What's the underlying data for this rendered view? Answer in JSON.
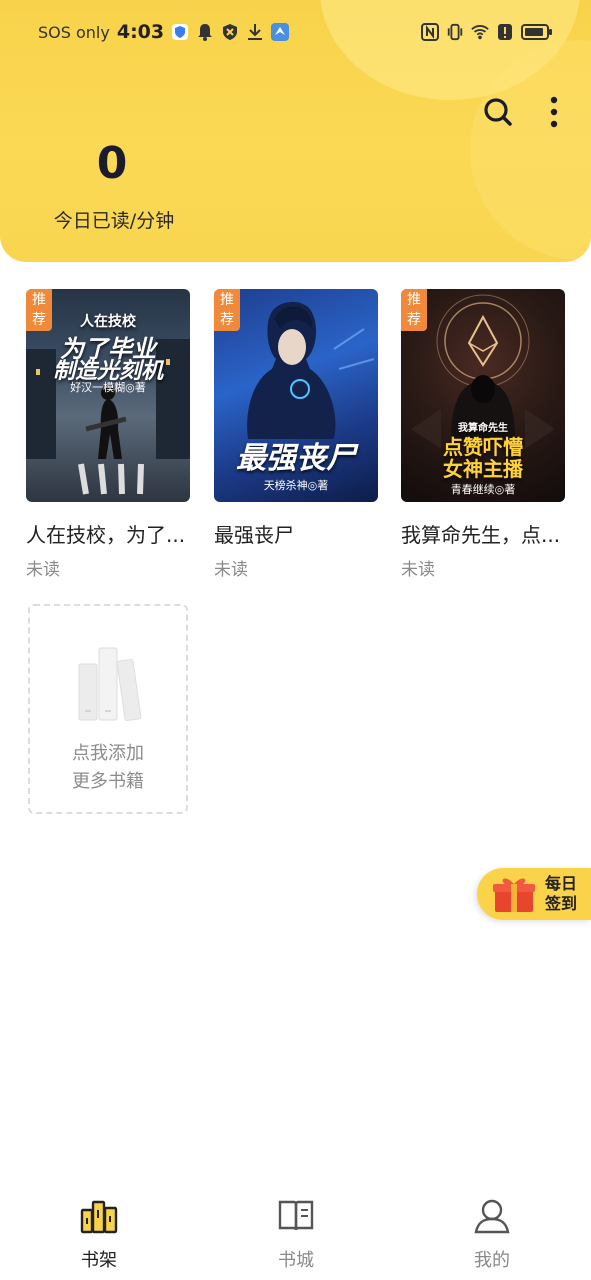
{
  "statusbar": {
    "carrier": "SOS only",
    "time": "4:03"
  },
  "header": {
    "today_count": "0",
    "today_label": "今日已读/分钟"
  },
  "books": [
    {
      "tag": "推荐",
      "cover_title_line1": "人在技校",
      "cover_title_line2": "为了毕业",
      "cover_title_line3": "制造光刻机",
      "cover_author": "好汉一模糊◎著",
      "title": "人在技校，为了...",
      "status": "未读"
    },
    {
      "tag": "推荐",
      "cover_title_line1": "最强丧尸",
      "cover_author": "天榜杀神◎著",
      "title": "最强丧尸",
      "status": "未读"
    },
    {
      "tag": "推荐",
      "cover_title_line0": "我算命先生",
      "cover_title_line1": "点赞吓懵",
      "cover_title_line2": "女神主播",
      "cover_author": "青春继续◎著",
      "title": "我算命先生，点...",
      "status": "未读"
    }
  ],
  "add_more": {
    "line1": "点我添加",
    "line2": "更多书籍"
  },
  "checkin": {
    "line1": "每日",
    "line2": "签到"
  },
  "nav": [
    {
      "label": "书架",
      "active": true
    },
    {
      "label": "书城",
      "active": false
    },
    {
      "label": "我的",
      "active": false
    }
  ],
  "colors": {
    "accent": "#f9d24b",
    "tag": "#f08a3a",
    "active_nav": "#222222",
    "inactive_nav": "#8a8a8a"
  }
}
